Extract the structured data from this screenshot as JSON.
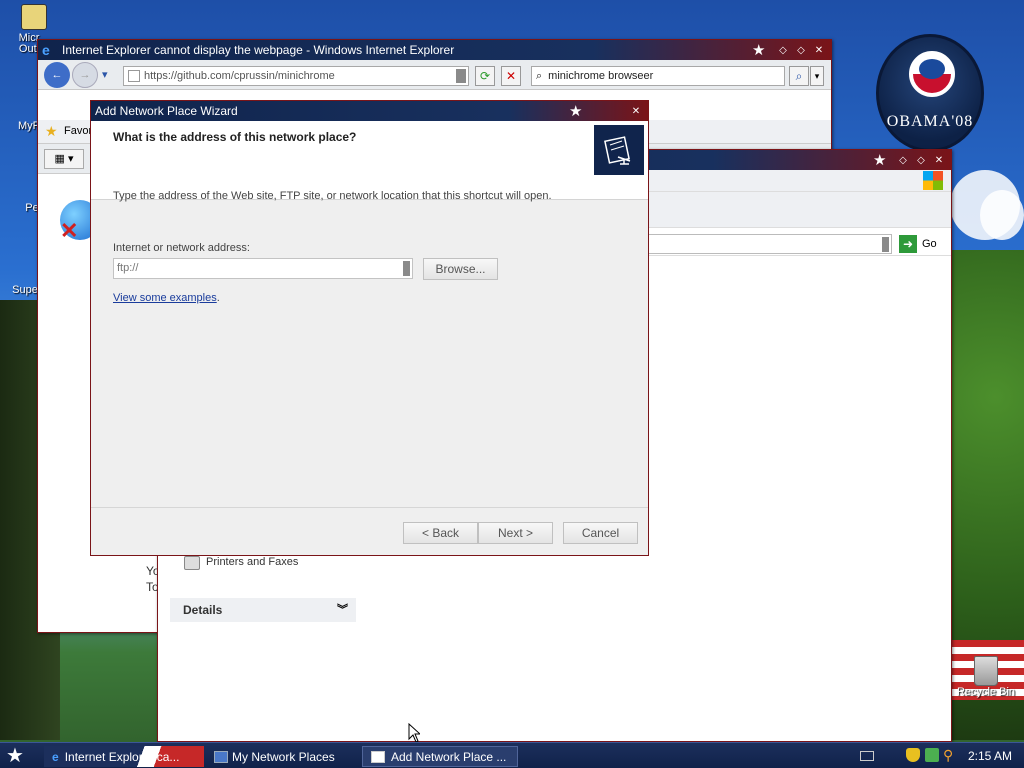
{
  "desktop": {
    "icons": [
      {
        "label": "Micr Outl"
      },
      {
        "label": "MyP"
      },
      {
        "label": "Pe"
      },
      {
        "label": "Supe"
      },
      {
        "label": "Recycle Bin"
      }
    ],
    "logo_text": "OBAMA'08"
  },
  "ie_window": {
    "title": "Internet Explorer cannot display the webpage - Windows Internet Explorer",
    "address": "https://github.com/cprussin/minichrome",
    "search_value": "minichrome browseer",
    "favorites_label": "Favor",
    "body_text_1": "Yo",
    "body_text_2": "To"
  },
  "explorer_window": {
    "go_label": "Go",
    "task_item": "Printers and Faxes",
    "details_label": "Details"
  },
  "wizard": {
    "title": "Add Network Place Wizard",
    "heading": "What is the address of this network place?",
    "description": "Type the address of the Web site, FTP site, or network location that this shortcut will open.",
    "field_label": "Internet or network address:",
    "field_value": "ftp://",
    "browse_label": "Browse...",
    "examples_link": "View some examples",
    "examples_period": ".",
    "back_label": "< Back",
    "next_label": "Next >",
    "cancel_label": "Cancel"
  },
  "taskbar": {
    "tasks": [
      {
        "label": "Internet Explorer ca..."
      },
      {
        "label": "My Network Places"
      },
      {
        "label": "Add Network Place ..."
      }
    ],
    "clock": "2:15 AM"
  }
}
